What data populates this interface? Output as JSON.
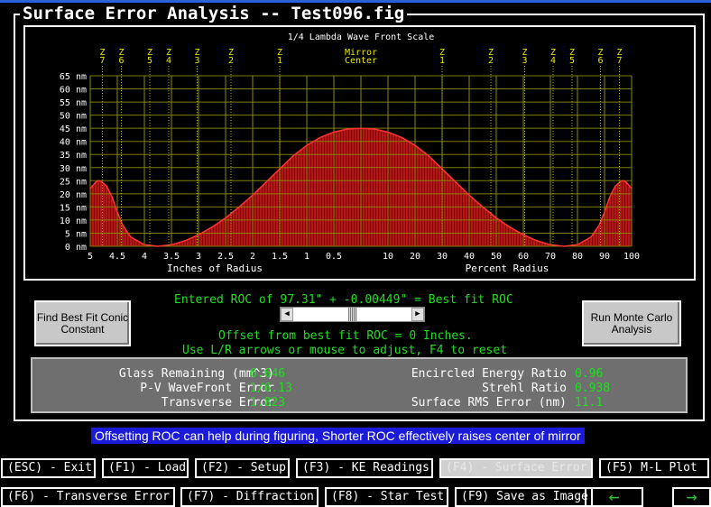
{
  "window": {
    "title": "Surface Error Analysis -- Test096.fig"
  },
  "chart_data": {
    "type": "area",
    "title": "1/4 Lambda Wave Front Scale",
    "ylabel_unit": "nm",
    "ylim": [
      0,
      65
    ],
    "yticks": [
      "65 nm",
      "60 nm",
      "55 nm",
      "50 nm",
      "45 nm",
      "40 nm",
      "35 nm",
      "30 nm",
      "25 nm",
      "20 nm",
      "15 nm",
      "10 nm",
      "5 nm",
      "0 nm"
    ],
    "left_axis": {
      "label": "Inches of Radius",
      "ticks": [
        "5",
        "4.5",
        "4",
        "3.5",
        "3",
        "2.5",
        "2",
        "1.5",
        "1",
        "0.5"
      ]
    },
    "right_axis": {
      "label": "Percent Radius",
      "ticks": [
        "10",
        "20",
        "30",
        "40",
        "50",
        "60",
        "70",
        "80",
        "90",
        "100"
      ]
    },
    "center_label": [
      "Mirror",
      "Center"
    ],
    "zone_labels": [
      "7",
      "6",
      "5",
      "4",
      "3",
      "2",
      "1",
      "1",
      "2",
      "3",
      "4",
      "5",
      "6",
      "7"
    ],
    "zone_prefix": "Z",
    "profile": {
      "radius_pct": [
        0,
        5,
        10,
        15,
        20,
        25,
        30,
        35,
        40,
        45,
        50,
        55,
        60,
        65,
        70,
        75,
        80,
        85,
        88,
        90,
        92,
        94,
        96,
        97,
        98,
        100
      ],
      "error_nm": [
        45,
        44.7,
        43.5,
        41.5,
        38.5,
        34.5,
        29.5,
        24.5,
        19.5,
        15.0,
        10.8,
        7.3,
        4.4,
        2.1,
        0.6,
        0.0,
        0.6,
        3.5,
        8.0,
        13.0,
        19.0,
        23.0,
        24.8,
        25.0,
        24.5,
        22.0
      ]
    },
    "fill_color": "#8a0000",
    "line_color": "#ff3333",
    "grid_color": "#8a8a00"
  },
  "roc": {
    "entered_line": "Entered ROC of 97.31\" + -0.00449\" = Best fit ROC",
    "offset_line": "Offset from best fit ROC = 0 Inches.",
    "hint_line": "Use L/R arrows or mouse to adjust, F4 to reset",
    "slider_position": 0.5
  },
  "buttons": {
    "find_conic": "Find Best Fit Conic Constant",
    "monte_carlo": "Run Monte Carlo Analysis"
  },
  "results": {
    "glass_label": "Glass Remaining (mm^3)",
    "glass_value": "0.646",
    "pv_label": "P-V WaveFront Error",
    "pv_value": "1/6.13",
    "trans_label": "Transverse Error",
    "trans_value": "1.823",
    "ee_label": "Encircled Energy Ratio",
    "ee_value": "0.96",
    "strehl_label": "Strehl Ratio",
    "strehl_value": "0.938",
    "rms_label": "Surface RMS Error (nm)",
    "rms_value": "11.1"
  },
  "hint": "Offsetting ROC can help during figuring, Shorter ROC effectively raises center of mirror",
  "keys": {
    "esc": "(ESC) - Exit",
    "f1": "(F1) - Load",
    "f2": "(F2) - Setup",
    "f3": "(F3) - KE Readings",
    "f4": "(F4) - Surface Error",
    "f5": "(F5) M-L Plot",
    "f6": "(F6) - Transverse Error",
    "f7": "(F7) - Diffraction",
    "f8": "(F8) - Star Test",
    "f9": "(F9) Save as Image",
    "prev": "←",
    "next": "→"
  }
}
